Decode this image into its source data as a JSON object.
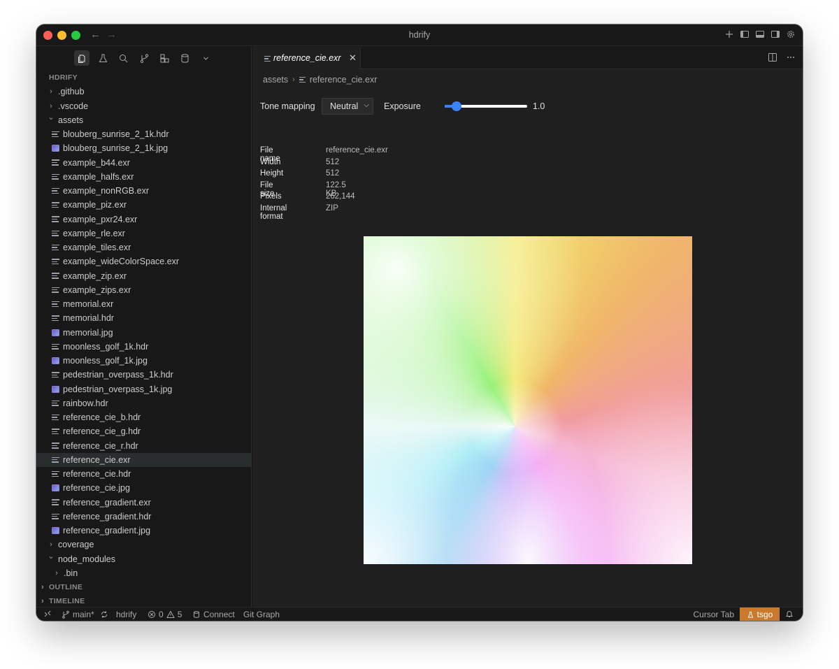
{
  "window": {
    "title": "hdrify"
  },
  "explorer": {
    "root_label": "HDRIFY",
    "items": [
      {
        "label": ".github",
        "type": "folder",
        "depth": 1,
        "expanded": false
      },
      {
        "label": ".vscode",
        "type": "folder",
        "depth": 1,
        "expanded": false
      },
      {
        "label": "assets",
        "type": "folder",
        "depth": 1,
        "expanded": true
      },
      {
        "label": "blouberg_sunrise_2_1k.hdr",
        "type": "file",
        "depth": 2
      },
      {
        "label": "blouberg_sunrise_2_1k.jpg",
        "type": "image",
        "depth": 2
      },
      {
        "label": "example_b44.exr",
        "type": "file",
        "depth": 2
      },
      {
        "label": "example_halfs.exr",
        "type": "file",
        "depth": 2
      },
      {
        "label": "example_nonRGB.exr",
        "type": "file",
        "depth": 2
      },
      {
        "label": "example_piz.exr",
        "type": "file",
        "depth": 2
      },
      {
        "label": "example_pxr24.exr",
        "type": "file",
        "depth": 2
      },
      {
        "label": "example_rle.exr",
        "type": "file",
        "depth": 2
      },
      {
        "label": "example_tiles.exr",
        "type": "file",
        "depth": 2
      },
      {
        "label": "example_wideColorSpace.exr",
        "type": "file",
        "depth": 2
      },
      {
        "label": "example_zip.exr",
        "type": "file",
        "depth": 2
      },
      {
        "label": "example_zips.exr",
        "type": "file",
        "depth": 2
      },
      {
        "label": "memorial.exr",
        "type": "file",
        "depth": 2
      },
      {
        "label": "memorial.hdr",
        "type": "file",
        "depth": 2
      },
      {
        "label": "memorial.jpg",
        "type": "image",
        "depth": 2
      },
      {
        "label": "moonless_golf_1k.hdr",
        "type": "file",
        "depth": 2
      },
      {
        "label": "moonless_golf_1k.jpg",
        "type": "image",
        "depth": 2
      },
      {
        "label": "pedestrian_overpass_1k.hdr",
        "type": "file",
        "depth": 2
      },
      {
        "label": "pedestrian_overpass_1k.jpg",
        "type": "image",
        "depth": 2
      },
      {
        "label": "rainbow.hdr",
        "type": "file",
        "depth": 2
      },
      {
        "label": "reference_cie_b.hdr",
        "type": "file",
        "depth": 2
      },
      {
        "label": "reference_cie_g.hdr",
        "type": "file",
        "depth": 2
      },
      {
        "label": "reference_cie_r.hdr",
        "type": "file",
        "depth": 2
      },
      {
        "label": "reference_cie.exr",
        "type": "file",
        "depth": 2,
        "selected": true
      },
      {
        "label": "reference_cie.hdr",
        "type": "file",
        "depth": 2
      },
      {
        "label": "reference_cie.jpg",
        "type": "image",
        "depth": 2
      },
      {
        "label": "reference_gradient.exr",
        "type": "file",
        "depth": 2
      },
      {
        "label": "reference_gradient.hdr",
        "type": "file",
        "depth": 2
      },
      {
        "label": "reference_gradient.jpg",
        "type": "image",
        "depth": 2
      },
      {
        "label": "coverage",
        "type": "folder",
        "depth": 1,
        "expanded": false
      },
      {
        "label": "node_modules",
        "type": "folder",
        "depth": 1,
        "expanded": true
      },
      {
        "label": ".bin",
        "type": "folder",
        "depth": 2,
        "expanded": false
      }
    ],
    "outline_label": "OUTLINE",
    "timeline_label": "TIMELINE"
  },
  "editor": {
    "tab_label": "reference_cie.exr",
    "breadcrumb": [
      "assets",
      "reference_cie.exr"
    ],
    "tone_mapping_label": "Tone mapping",
    "tone_mapping_value": "Neutral",
    "exposure_label": "Exposure",
    "exposure_value": "1.0",
    "exposure_slider_fraction": 0.14,
    "info": [
      {
        "key": "File name",
        "value": "reference_cie.exr"
      },
      {
        "key": "Width",
        "value": "512"
      },
      {
        "key": "Height",
        "value": "512"
      },
      {
        "key": "File size",
        "value": "122.5 KB"
      },
      {
        "key": "Pixels",
        "value": "262,144"
      },
      {
        "key": "Internal format",
        "value": "ZIP"
      }
    ]
  },
  "statusbar": {
    "branch": "main*",
    "project": "hdrify",
    "errors": "0",
    "warnings": "5",
    "connect": "Connect",
    "git_graph": "Git Graph",
    "cursor_tab": "Cursor Tab",
    "tsgo": "tsgo"
  },
  "colors": {
    "accent": "#3b82f6",
    "tsgo_badge": "#c97a2c",
    "background": "#1f1f1f"
  }
}
